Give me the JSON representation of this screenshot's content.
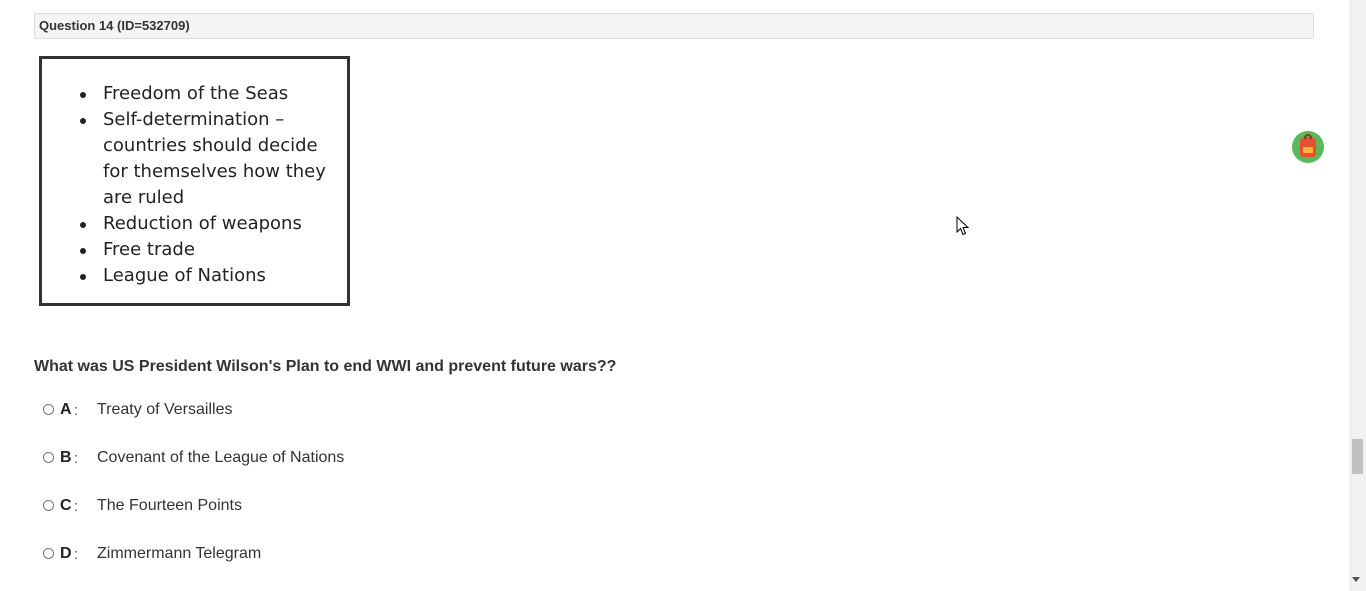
{
  "question_header": "Question 14 (ID=532709)",
  "stimulus": {
    "items": [
      "Freedom of the Seas",
      "Self-determination – countries should decide for themselves how they are ruled",
      "Reduction of weapons",
      "Free trade",
      "League of Nations"
    ]
  },
  "question": "What was US President Wilson's Plan to end WWI and prevent future wars??",
  "options": [
    {
      "letter": "A",
      "text": "Treaty of Versailles"
    },
    {
      "letter": "B",
      "text": "Covenant of the League of Nations"
    },
    {
      "letter": "C",
      "text": "The Fourteen Points"
    },
    {
      "letter": "D",
      "text": "Zimmermann Telegram"
    }
  ],
  "icons": {
    "avatar": "backpack-icon",
    "cursor": "mouse-pointer-icon"
  },
  "colors": {
    "avatar_bg": "#5cb85c",
    "backpack": "#e8512f"
  }
}
